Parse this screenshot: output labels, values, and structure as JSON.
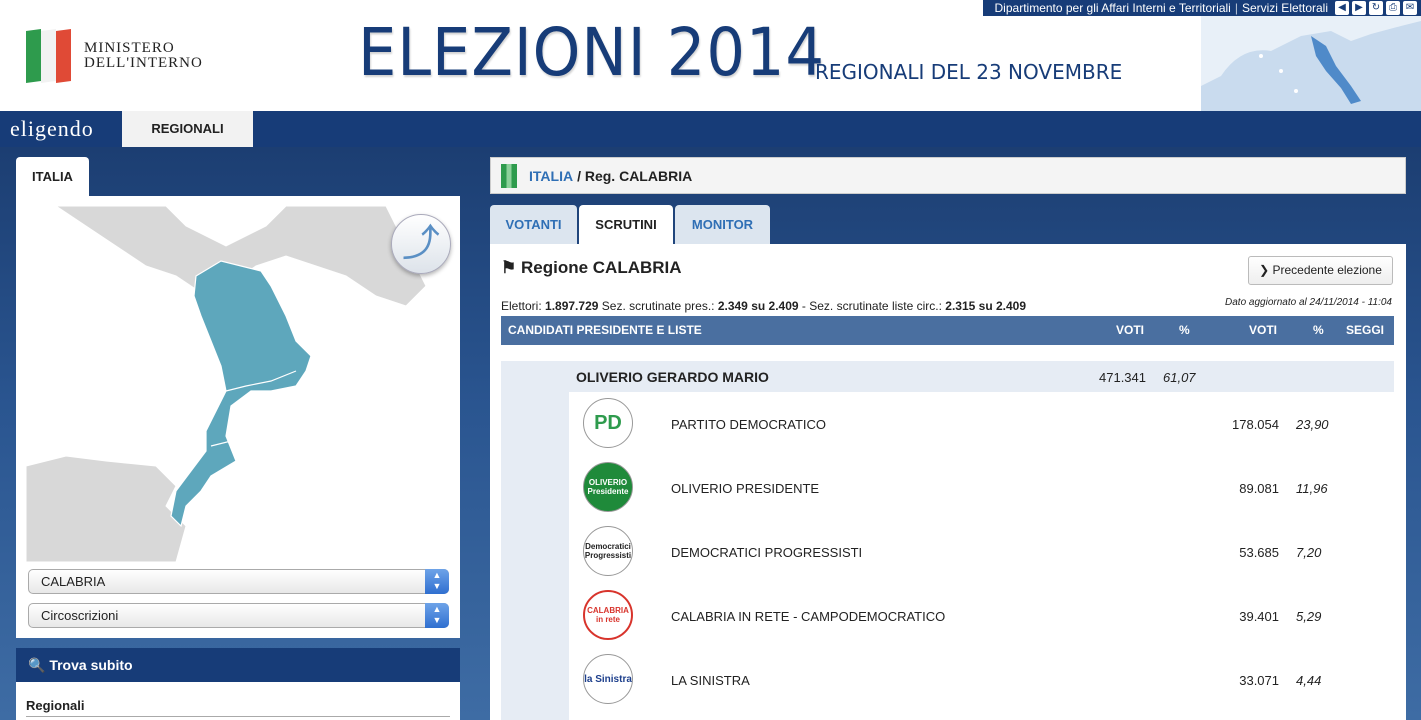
{
  "header": {
    "ministry_line1": "MINISTERO",
    "ministry_line2": "DELL'INTERNO",
    "title": "ELEZIONI 2014",
    "subtitle": "REGIONALI DEL 23 NOVEMBRE",
    "top_links": [
      "Dipartimento per gli Affari Interni e Territoriali",
      "Servizi Elettorali"
    ],
    "top_icons": [
      "back-icon",
      "forward-icon",
      "refresh-icon",
      "print-icon",
      "mail-icon"
    ]
  },
  "nav": {
    "brand": "eligendo",
    "tab": "REGIONALI"
  },
  "left": {
    "tab": "ITALIA",
    "region_select": "CALABRIA",
    "circ_select": "Circoscrizioni",
    "search_title": "Trova subito",
    "search_label": "Regionali",
    "map_color": "#5ea7bc"
  },
  "breadcrumb": {
    "root": "ITALIA",
    "current": "/ Reg. CALABRIA"
  },
  "tabs": [
    "VOTANTI",
    "SCRUTINI",
    "MONITOR"
  ],
  "content": {
    "region_title": "Regione CALABRIA",
    "prev_button": "Precedente elezione",
    "elettori_label": "Elettori:",
    "elettori_value": "1.897.729",
    "sez_pres_label": "Sez. scrutinate pres.:",
    "sez_pres_value": "2.349 su 2.409",
    "sez_liste_label": "- Sez. scrutinate liste circ.:",
    "sez_liste_value": "2.315 su 2.409",
    "updated": "Dato aggiornato al 24/11/2014 - 11:04",
    "headers": {
      "candidati": "CANDIDATI PRESIDENTE E LISTE",
      "voti1": "VOTI",
      "pct1": "%",
      "voti2": "VOTI",
      "pct2": "%",
      "seggi": "SEGGI"
    },
    "candidate": {
      "name": "OLIVERIO GERARDO MARIO",
      "votes": "471.341",
      "pct": "61,07"
    },
    "lists": [
      {
        "name": "PARTITO DEMOCRATICO",
        "votes": "178.054",
        "pct": "23,90",
        "logo": "PD",
        "logo_color": "#2e9b4d"
      },
      {
        "name": "OLIVERIO PRESIDENTE",
        "votes": "89.081",
        "pct": "11,96",
        "logo": "OLIVERIO Presidente",
        "logo_color": "#1f8a3a"
      },
      {
        "name": "DEMOCRATICI PROGRESSISTI",
        "votes": "53.685",
        "pct": "7,20",
        "logo": "Democratici Progressisti",
        "logo_color": "#d8342c"
      },
      {
        "name": "CALABRIA IN RETE - CAMPODEMOCRATICO",
        "votes": "39.401",
        "pct": "5,29",
        "logo": "CALABRIA in rete",
        "logo_color": "#d8342c"
      },
      {
        "name": "LA SINISTRA",
        "votes": "33.071",
        "pct": "4,44",
        "logo": "la Sinistra",
        "logo_color": "#1d3f8c"
      }
    ]
  }
}
